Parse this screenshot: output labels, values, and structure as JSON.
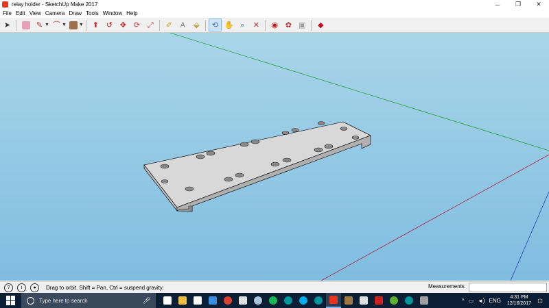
{
  "window": {
    "title": "relay holder - SketchUp Make 2017",
    "minimize": "─",
    "restore": "❐",
    "close": "✕"
  },
  "menu": [
    "File",
    "Edit",
    "View",
    "Camera",
    "Draw",
    "Tools",
    "Window",
    "Help"
  ],
  "toolbar": {
    "tools": [
      {
        "name": "select-tool",
        "color": "#333333",
        "glyph": "➤"
      },
      {
        "name": "eraser-tool",
        "color": "#e8a0b8",
        "glyph": ""
      },
      {
        "name": "line-tool",
        "color": "#b03030",
        "glyph": "✎"
      },
      {
        "name": "arc-tool",
        "color": "#c04040",
        "glyph": "⌒"
      },
      {
        "name": "shape-tool",
        "color": "#a0704a",
        "glyph": ""
      },
      {
        "name": "push-pull-tool",
        "color": "#c03030",
        "glyph": "⬆"
      },
      {
        "name": "follow-me-tool",
        "color": "#b02020",
        "glyph": "↺"
      },
      {
        "name": "move-tool",
        "color": "#c82020",
        "glyph": "✥"
      },
      {
        "name": "rotate-tool",
        "color": "#d03030",
        "glyph": "⟳"
      },
      {
        "name": "scale-tool",
        "color": "#b04040",
        "glyph": "⤢"
      },
      {
        "name": "tape-measure-tool",
        "color": "#caa020",
        "glyph": "✐"
      },
      {
        "name": "text-tool",
        "color": "#808080",
        "glyph": "A"
      },
      {
        "name": "paint-bucket-tool",
        "color": "#c0a030",
        "glyph": "⬙"
      },
      {
        "name": "orbit-tool",
        "color": "#3a6ab0",
        "glyph": "⟲"
      },
      {
        "name": "pan-tool",
        "color": "#e0c080",
        "glyph": "✋"
      },
      {
        "name": "zoom-tool",
        "color": "#3060a0",
        "glyph": "⌕"
      },
      {
        "name": "zoom-extents-tool",
        "color": "#c03030",
        "glyph": "✕"
      },
      {
        "name": "warehouse-tool",
        "color": "#c02020",
        "glyph": "◉"
      },
      {
        "name": "extension-warehouse-tool",
        "color": "#c03030",
        "glyph": "✿"
      },
      {
        "name": "share-model-tool",
        "color": "#9a9a9a",
        "glyph": "▣"
      },
      {
        "name": "ruby-tool",
        "color": "#c01020",
        "glyph": "◆"
      }
    ]
  },
  "status": {
    "hint": "Drag to orbit.  Shift = Pan, Ctrl = suspend gravity.",
    "measurements_label": "Measurements",
    "measurements_value": ""
  },
  "taskbar": {
    "search_placeholder": "Type here to search",
    "language": "ENG",
    "time": "4:31 PM",
    "date": "12/16/2017",
    "apps": [
      {
        "name": "task-view",
        "color": "#ffffff"
      },
      {
        "name": "file-explorer",
        "color": "#f0c040"
      },
      {
        "name": "movies",
        "color": "#ffffff"
      },
      {
        "name": "edge",
        "color": "#3a8de0"
      },
      {
        "name": "chrome",
        "color": "#e04030"
      },
      {
        "name": "mail",
        "color": "#e0e0e0"
      },
      {
        "name": "steam",
        "color": "#aac4dc"
      },
      {
        "name": "spotify",
        "color": "#1db954"
      },
      {
        "name": "arduino",
        "color": "#00979c"
      },
      {
        "name": "skype",
        "color": "#00aff0"
      },
      {
        "name": "arduino-2",
        "color": "#00979c"
      },
      {
        "name": "sketchup",
        "color": "#e8341c"
      },
      {
        "name": "app-brown",
        "color": "#a07840"
      },
      {
        "name": "photos",
        "color": "#e0e0e0"
      },
      {
        "name": "flash",
        "color": "#d02020"
      },
      {
        "name": "utorrent",
        "color": "#60b030"
      },
      {
        "name": "arduino-3",
        "color": "#00979c"
      },
      {
        "name": "settings",
        "color": "#a0a0a0"
      }
    ]
  }
}
